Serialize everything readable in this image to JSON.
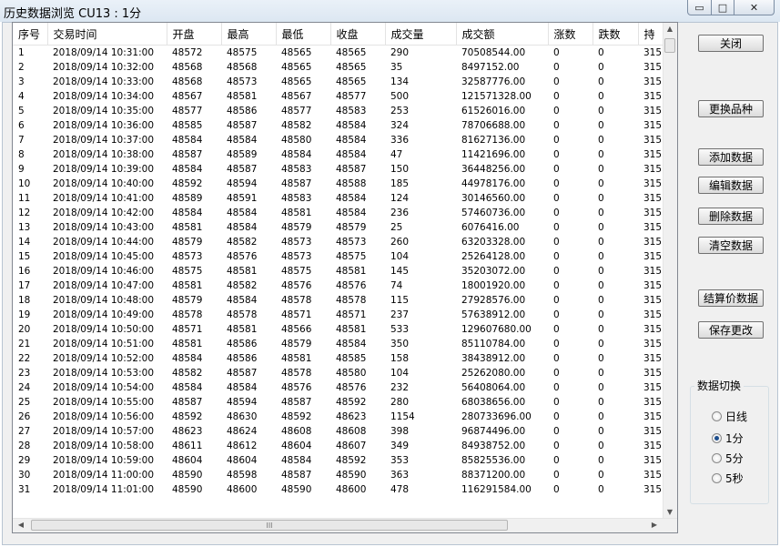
{
  "window": {
    "title": "历史数据浏览 CU13 : 1分"
  },
  "window_controls": {
    "minimize": "▭",
    "maximize": "□",
    "close": "✕"
  },
  "table": {
    "headers": [
      "序号",
      "交易时间",
      "开盘",
      "最高",
      "最低",
      "收盘",
      "成交量",
      "成交额",
      "涨数",
      "跌数",
      "持仓"
    ],
    "header_last_visible": "持",
    "rows": [
      [
        "1",
        "2018/09/14 10:31:00",
        "48572",
        "48575",
        "48565",
        "48565",
        "290",
        "70508544.00",
        "0",
        "0",
        "315"
      ],
      [
        "2",
        "2018/09/14 10:32:00",
        "48568",
        "48568",
        "48565",
        "48565",
        "35",
        "8497152.00",
        "0",
        "0",
        "315"
      ],
      [
        "3",
        "2018/09/14 10:33:00",
        "48568",
        "48573",
        "48565",
        "48565",
        "134",
        "32587776.00",
        "0",
        "0",
        "315"
      ],
      [
        "4",
        "2018/09/14 10:34:00",
        "48567",
        "48581",
        "48567",
        "48577",
        "500",
        "121571328.00",
        "0",
        "0",
        "315"
      ],
      [
        "5",
        "2018/09/14 10:35:00",
        "48577",
        "48586",
        "48577",
        "48583",
        "253",
        "61526016.00",
        "0",
        "0",
        "315"
      ],
      [
        "6",
        "2018/09/14 10:36:00",
        "48585",
        "48587",
        "48582",
        "48584",
        "324",
        "78706688.00",
        "0",
        "0",
        "315"
      ],
      [
        "7",
        "2018/09/14 10:37:00",
        "48584",
        "48584",
        "48580",
        "48584",
        "336",
        "81627136.00",
        "0",
        "0",
        "315"
      ],
      [
        "8",
        "2018/09/14 10:38:00",
        "48587",
        "48589",
        "48584",
        "48584",
        "47",
        "11421696.00",
        "0",
        "0",
        "315"
      ],
      [
        "9",
        "2018/09/14 10:39:00",
        "48584",
        "48587",
        "48583",
        "48587",
        "150",
        "36448256.00",
        "0",
        "0",
        "315"
      ],
      [
        "10",
        "2018/09/14 10:40:00",
        "48592",
        "48594",
        "48587",
        "48588",
        "185",
        "44978176.00",
        "0",
        "0",
        "315"
      ],
      [
        "11",
        "2018/09/14 10:41:00",
        "48589",
        "48591",
        "48583",
        "48584",
        "124",
        "30146560.00",
        "0",
        "0",
        "315"
      ],
      [
        "12",
        "2018/09/14 10:42:00",
        "48584",
        "48584",
        "48581",
        "48584",
        "236",
        "57460736.00",
        "0",
        "0",
        "315"
      ],
      [
        "13",
        "2018/09/14 10:43:00",
        "48581",
        "48584",
        "48579",
        "48579",
        "25",
        "6076416.00",
        "0",
        "0",
        "315"
      ],
      [
        "14",
        "2018/09/14 10:44:00",
        "48579",
        "48582",
        "48573",
        "48573",
        "260",
        "63203328.00",
        "0",
        "0",
        "315"
      ],
      [
        "15",
        "2018/09/14 10:45:00",
        "48573",
        "48576",
        "48573",
        "48575",
        "104",
        "25264128.00",
        "0",
        "0",
        "315"
      ],
      [
        "16",
        "2018/09/14 10:46:00",
        "48575",
        "48581",
        "48575",
        "48581",
        "145",
        "35203072.00",
        "0",
        "0",
        "315"
      ],
      [
        "17",
        "2018/09/14 10:47:00",
        "48581",
        "48582",
        "48576",
        "48576",
        "74",
        "18001920.00",
        "0",
        "0",
        "315"
      ],
      [
        "18",
        "2018/09/14 10:48:00",
        "48579",
        "48584",
        "48578",
        "48578",
        "115",
        "27928576.00",
        "0",
        "0",
        "315"
      ],
      [
        "19",
        "2018/09/14 10:49:00",
        "48578",
        "48578",
        "48571",
        "48571",
        "237",
        "57638912.00",
        "0",
        "0",
        "315"
      ],
      [
        "20",
        "2018/09/14 10:50:00",
        "48571",
        "48581",
        "48566",
        "48581",
        "533",
        "129607680.00",
        "0",
        "0",
        "315"
      ],
      [
        "21",
        "2018/09/14 10:51:00",
        "48581",
        "48586",
        "48579",
        "48584",
        "350",
        "85110784.00",
        "0",
        "0",
        "315"
      ],
      [
        "22",
        "2018/09/14 10:52:00",
        "48584",
        "48586",
        "48581",
        "48585",
        "158",
        "38438912.00",
        "0",
        "0",
        "315"
      ],
      [
        "23",
        "2018/09/14 10:53:00",
        "48582",
        "48587",
        "48578",
        "48580",
        "104",
        "25262080.00",
        "0",
        "0",
        "315"
      ],
      [
        "24",
        "2018/09/14 10:54:00",
        "48584",
        "48584",
        "48576",
        "48576",
        "232",
        "56408064.00",
        "0",
        "0",
        "315"
      ],
      [
        "25",
        "2018/09/14 10:55:00",
        "48587",
        "48594",
        "48587",
        "48592",
        "280",
        "68038656.00",
        "0",
        "0",
        "315"
      ],
      [
        "26",
        "2018/09/14 10:56:00",
        "48592",
        "48630",
        "48592",
        "48623",
        "1154",
        "280733696.00",
        "0",
        "0",
        "315"
      ],
      [
        "27",
        "2018/09/14 10:57:00",
        "48623",
        "48624",
        "48608",
        "48608",
        "398",
        "96874496.00",
        "0",
        "0",
        "315"
      ],
      [
        "28",
        "2018/09/14 10:58:00",
        "48611",
        "48612",
        "48604",
        "48607",
        "349",
        "84938752.00",
        "0",
        "0",
        "315"
      ],
      [
        "29",
        "2018/09/14 10:59:00",
        "48604",
        "48604",
        "48584",
        "48592",
        "353",
        "85825536.00",
        "0",
        "0",
        "315"
      ],
      [
        "30",
        "2018/09/14 11:00:00",
        "48590",
        "48598",
        "48587",
        "48590",
        "363",
        "88371200.00",
        "0",
        "0",
        "315"
      ],
      [
        "31",
        "2018/09/14 11:01:00",
        "48590",
        "48600",
        "48590",
        "48600",
        "478",
        "116291584.00",
        "0",
        "0",
        "315"
      ]
    ]
  },
  "scrollbars": {
    "up": "▲",
    "down": "▼",
    "left": "◀",
    "right": "▶",
    "grip": "III"
  },
  "buttons": {
    "close": "关闭",
    "change_symbol": "更换品种",
    "add_data": "添加数据",
    "edit_data": "编辑数据",
    "delete_data": "删除数据",
    "clear_data": "清空数据",
    "settlement_data": "结算价数据",
    "save_changes": "保存更改"
  },
  "data_switch": {
    "title": "数据切换",
    "selected": "1分",
    "options": [
      "日线",
      "1分",
      "5分",
      "5秒"
    ]
  }
}
